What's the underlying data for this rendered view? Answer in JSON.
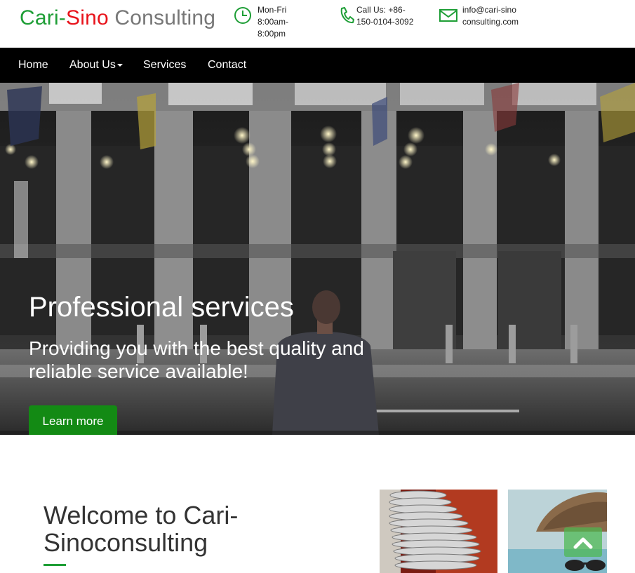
{
  "brand": {
    "part1": "Cari-",
    "part2": "Sino",
    "part3": " Consulting"
  },
  "contact": {
    "hours": "Mon-Fri\n8:00am-\n8:00pm",
    "phone": "Call Us: +86-\n150-0104-3092",
    "email": "info@cari-sino\nconsulting.com",
    "hours_icon": "clock-icon",
    "phone_icon": "phone-icon",
    "email_icon": "envelope-icon"
  },
  "nav": {
    "home": "Home",
    "about": "About Us",
    "services": "Services",
    "contact": "Contact"
  },
  "hero": {
    "title": "Professional services",
    "subtitle": "Providing you with the best quality and reliable service available!",
    "button": "Learn more"
  },
  "welcome": {
    "title": "Welcome to Cari-\nSinoconsulting"
  },
  "scroll_top_icon": "chevron-up-icon",
  "colors": {
    "accent": "#1e9e36",
    "red": "#e8141c",
    "button": "#138a14",
    "nav": "#000000"
  }
}
